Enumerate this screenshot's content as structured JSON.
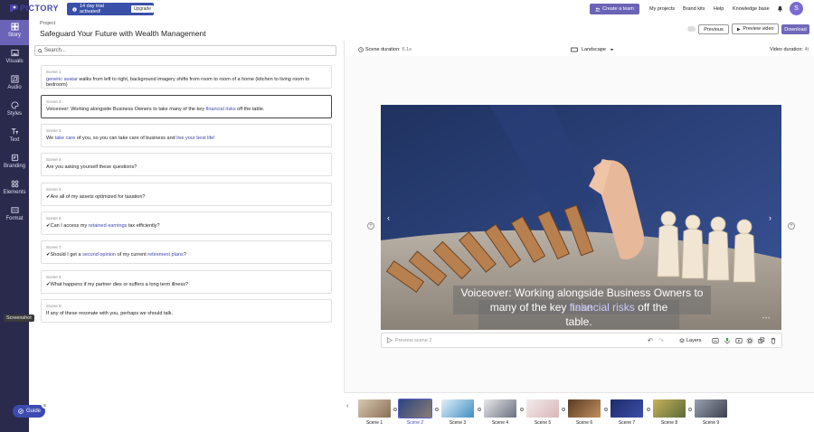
{
  "brand": {
    "name": "PICTORY"
  },
  "trial": {
    "text": "14 day trial activated!",
    "upgrade": "Upgrade"
  },
  "topnav": {
    "create_team": "Create a team",
    "items": [
      "My projects",
      "Brand kits",
      "Help",
      "Knowledge base"
    ],
    "avatar_initial": "S"
  },
  "sidebar": {
    "items": [
      {
        "label": "Story",
        "icon": "story-icon"
      },
      {
        "label": "Visuals",
        "icon": "image-icon"
      },
      {
        "label": "Audio",
        "icon": "music-icon"
      },
      {
        "label": "Styles",
        "icon": "palette-icon"
      },
      {
        "label": "Text",
        "icon": "text-icon"
      },
      {
        "label": "Branding",
        "icon": "brand-icon"
      },
      {
        "label": "Elements",
        "icon": "elements-icon"
      },
      {
        "label": "Format",
        "icon": "format-icon"
      }
    ],
    "screenshot_label": "Screenshot",
    "guide_label": "Guide",
    "guide_badge": "5"
  },
  "project": {
    "label": "Project",
    "title": "Safeguard Your Future with Wealth Management"
  },
  "header_buttons": {
    "previous": "Previous",
    "preview": "Preview video",
    "download": "Download"
  },
  "search": {
    "placeholder": "Search..."
  },
  "scenes": [
    {
      "num": "Scene 1",
      "parts": [
        [
          "hl",
          "generic avatar"
        ],
        [
          "t",
          " walks from left to right, background imagery shifts from room to room of a home (kitchen to living room to bedroom)"
        ]
      ]
    },
    {
      "num": "Scene 2",
      "parts": [
        [
          "t",
          "Voiceover: Working alongside Business Owners to take many of the key "
        ],
        [
          "hl",
          "financial risks"
        ],
        [
          "t",
          " off the table."
        ]
      ]
    },
    {
      "num": "Scene 3",
      "parts": [
        [
          "t",
          "We "
        ],
        [
          "hl",
          "take care"
        ],
        [
          "t",
          " of you, so you can take care of business and "
        ],
        [
          "hl",
          "live your best life!"
        ]
      ]
    },
    {
      "num": "Scene 4",
      "parts": [
        [
          "t",
          "Are you asking yourself these questions?"
        ]
      ]
    },
    {
      "num": "Scene 5",
      "parts": [
        [
          "t",
          "✔Are all of my assets optimized for taxation?"
        ]
      ]
    },
    {
      "num": "Scene 6",
      "parts": [
        [
          "t",
          "✔Can I access my "
        ],
        [
          "hl",
          "retained earnings"
        ],
        [
          "t",
          " tax efficiently?"
        ]
      ]
    },
    {
      "num": "Scene 7",
      "parts": [
        [
          "t",
          "✔Should I get a "
        ],
        [
          "hl",
          "second opinion"
        ],
        [
          "t",
          " of my current "
        ],
        [
          "hl",
          "retirement plans"
        ],
        [
          "t",
          "?"
        ]
      ]
    },
    {
      "num": "Scene 8",
      "parts": [
        [
          "t",
          "✔What happens if my partner dies or suffers a long term illness?"
        ]
      ]
    },
    {
      "num": "Scene 9",
      "parts": [
        [
          "t",
          "If any of these resonate with you, perhaps we should talk."
        ]
      ]
    }
  ],
  "editor": {
    "scene_duration_label": "Scene duration:",
    "scene_duration_value": "6.1s",
    "orientation": "Landscape",
    "video_duration_label": "Video duration:",
    "video_duration_value": "4t",
    "caption_line1": "Voiceover: Working alongside Business Owners to take",
    "caption_line2_pre": "many of the key ",
    "caption_line2_hl": "financial risks",
    "caption_line2_post": " off the table.",
    "preview_scene_placeholder": "Preview scene 2",
    "layers_label": "Layers"
  },
  "timeline": {
    "labels": [
      "Scene 1",
      "Scene 2",
      "Scene 3",
      "Scene 4",
      "Scene 5",
      "Scene 6",
      "Scene 7",
      "Scene 8",
      "Scene 9"
    ],
    "selected": "Scene 2"
  },
  "colors": {
    "accent": "#6b63b5",
    "rail": "#2a2a4d",
    "highlight": "#4049a8"
  }
}
